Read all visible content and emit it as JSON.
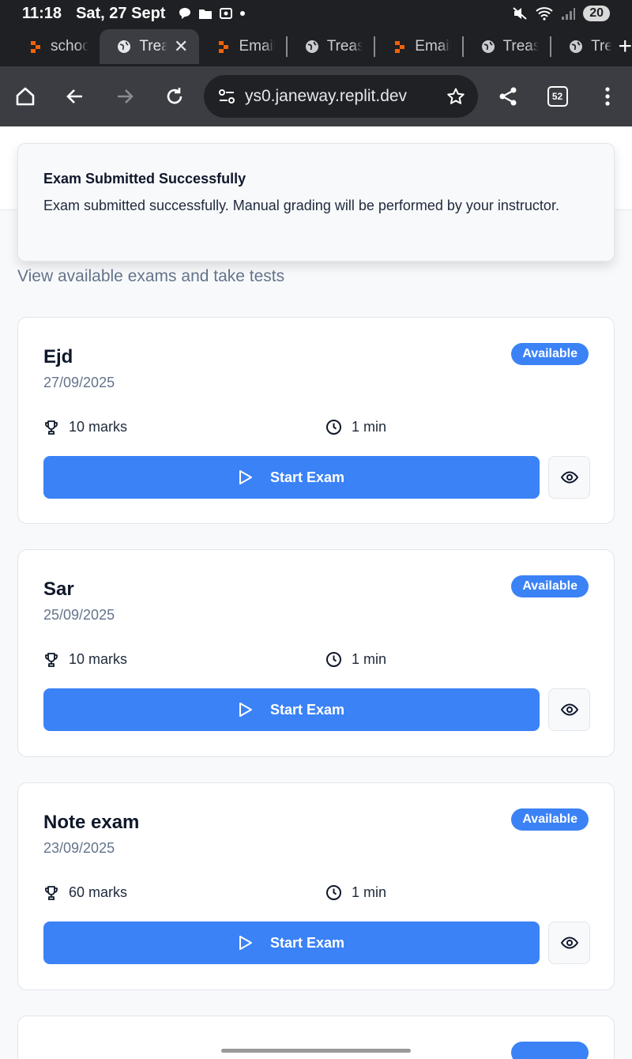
{
  "status_bar": {
    "time": "11:18",
    "date": "Sat, 27 Sept",
    "battery": "20"
  },
  "tabs": [
    {
      "label": "schoo",
      "favicon": "replit-icon",
      "active": false
    },
    {
      "label": "Trea",
      "favicon": "globe-icon",
      "active": true
    },
    {
      "label": "Email",
      "favicon": "replit-icon",
      "active": false
    },
    {
      "label": "Treas",
      "favicon": "globe-icon",
      "active": false
    },
    {
      "label": "Email",
      "favicon": "replit-icon",
      "active": false
    },
    {
      "label": "Treas",
      "favicon": "globe-icon",
      "active": false
    },
    {
      "label": "Trea",
      "favicon": "globe-icon",
      "active": false
    }
  ],
  "toolbar": {
    "url": "ys0.janeway.replit.dev",
    "tab_count": "52"
  },
  "toast": {
    "title": "Exam Submitted Successfully",
    "body": "Exam submitted successfully. Manual grading will be performed by your instructor."
  },
  "page": {
    "subtitle": "View available exams and take tests"
  },
  "exams": [
    {
      "name": "Ejd",
      "date": "27/09/2025",
      "status": "Available",
      "marks": "10 marks",
      "duration": "1 min",
      "start_label": "Start Exam"
    },
    {
      "name": "Sar",
      "date": "25/09/2025",
      "status": "Available",
      "marks": "10 marks",
      "duration": "1 min",
      "start_label": "Start Exam"
    },
    {
      "name": "Note exam",
      "date": "23/09/2025",
      "status": "Available",
      "marks": "60 marks",
      "duration": "1 min",
      "start_label": "Start Exam"
    }
  ],
  "colors": {
    "accent": "#3b82f6",
    "chrome_dark": "#1f2023",
    "toolbar": "#3c3d42"
  }
}
